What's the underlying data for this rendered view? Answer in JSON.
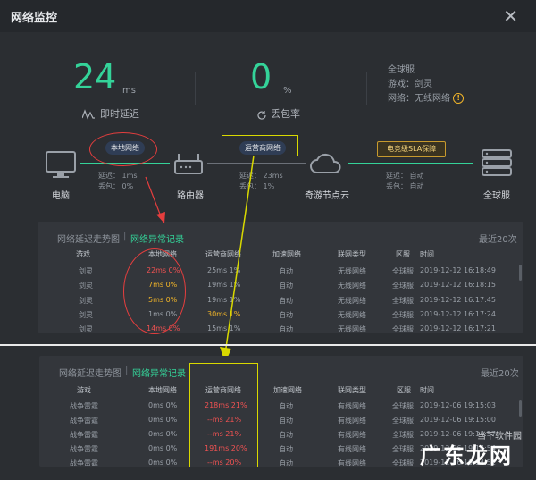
{
  "window": {
    "title": "网络监控",
    "close_icon": "close-icon"
  },
  "metrics": {
    "latency": {
      "value": "24",
      "unit": "ms",
      "label": "即时延迟"
    },
    "loss": {
      "value": "0",
      "unit": "%",
      "label": "丢包率"
    },
    "server_info": {
      "server": "全球服",
      "game": "游戏：剑灵",
      "network": "网络：无线网络"
    }
  },
  "path": {
    "computer": "电脑",
    "router": "路由器",
    "cloud": "奇游节点云",
    "server": "全球服",
    "local_net": "本地网络",
    "carrier_net": "运营商网络",
    "sla": "电竞级SLA保障",
    "router_stats": {
      "latency": "延迟：  1ms",
      "loss": "丢包：  0%"
    },
    "cloud_stats": {
      "latency": "延迟：  23ms",
      "loss": "丢包：  1%"
    },
    "server_stats": {
      "latency": "延迟：  自动",
      "loss": "丢包：  自动"
    }
  },
  "panel1": {
    "tab_trend": "网络延迟走势图",
    "tab_records": "网络异常记录",
    "recent": "最近20次",
    "headers": [
      "游戏",
      "本地网络",
      "运营商网络",
      "加速网络",
      "联网类型",
      "区服",
      "时间"
    ],
    "rows": [
      [
        "剑灵",
        "22ms 0%",
        "25ms 1%",
        "自动",
        "无线网络",
        "全球服",
        "2019-12-12 16:18:49"
      ],
      [
        "剑灵",
        "7ms 0%",
        "19ms 1%",
        "自动",
        "无线网络",
        "全球服",
        "2019-12-12 16:18:15"
      ],
      [
        "剑灵",
        "5ms 0%",
        "19ms 1%",
        "自动",
        "无线网络",
        "全球服",
        "2019-12-12 16:17:45"
      ],
      [
        "剑灵",
        "1ms 0%",
        "30ms 1%",
        "自动",
        "无线网络",
        "全球服",
        "2019-12-12 16:17:24"
      ],
      [
        "剑灵",
        "14ms 0%",
        "15ms 1%",
        "自动",
        "无线网络",
        "全球服",
        "2019-12-12 16:17:21"
      ]
    ]
  },
  "panel2": {
    "tab_trend": "网络延迟走势图",
    "tab_records": "网络异常记录",
    "recent": "最近20次",
    "headers": [
      "游戏",
      "本地网络",
      "运营商网络",
      "加速网络",
      "联网类型",
      "区服",
      "时间"
    ],
    "rows": [
      [
        "战争雷霆",
        "0ms 0%",
        "218ms 21%",
        "自动",
        "有线网络",
        "全球服",
        "2019-12-06 19:15:03"
      ],
      [
        "战争雷霆",
        "0ms 0%",
        "--ms 21%",
        "自动",
        "有线网络",
        "全球服",
        "2019-12-06 19:15:00"
      ],
      [
        "战争雷霆",
        "0ms 0%",
        "--ms 21%",
        "自动",
        "有线网络",
        "全球服",
        "2019-12-06 19:14:57"
      ],
      [
        "战争雷霆",
        "0ms 0%",
        "191ms 20%",
        "自动",
        "有线网络",
        "全球服",
        "2019-12-06 19:14:54"
      ],
      [
        "战争雷霆",
        "0ms 0%",
        "--ms 20%",
        "自动",
        "有线网络",
        "全球服",
        "2019-12-06 19:14:51"
      ]
    ]
  },
  "watermark": {
    "text": "广东龙网",
    "sub": "当下软件园"
  },
  "colors": {
    "accent": "#34d399",
    "alert": "#f05252",
    "warn": "#f0b429",
    "annotation_red": "#e53e3e",
    "annotation_yellow": "#d9d900"
  }
}
